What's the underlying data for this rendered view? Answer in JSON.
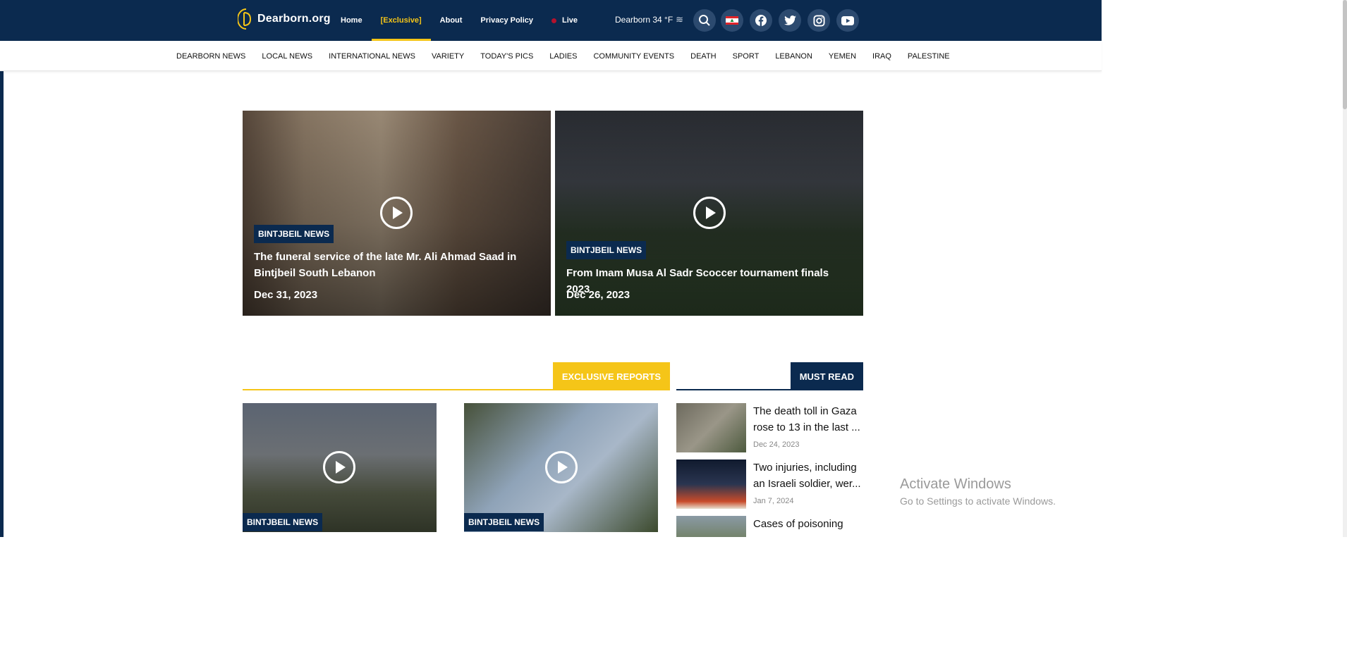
{
  "header": {
    "logo_text": "Dearborn.org",
    "nav": [
      {
        "label": "Home",
        "active": false
      },
      {
        "label": "[Exclusive]",
        "active": true
      },
      {
        "label": "About",
        "active": false
      },
      {
        "label": "Privacy Policy",
        "active": false
      },
      {
        "label": "Live",
        "active": false
      }
    ],
    "weather": "Dearborn 34 °F",
    "weather_icon": "fog-icon",
    "icons": [
      "search-icon",
      "lebanon-flag-icon",
      "facebook-icon",
      "twitter-icon",
      "instagram-icon",
      "youtube-icon"
    ],
    "brand_color": "#0b2a4f",
    "accent_color": "#f5c518"
  },
  "categories": [
    "DEARBORN NEWS",
    "LOCAL NEWS",
    "INTERNATIONAL NEWS",
    "VARIETY",
    "TODAY'S PICS",
    "LADIES",
    "COMMUNITY EVENTS",
    "DEATH",
    "SPORT",
    "LEBANON",
    "YEMEN",
    "IRAQ",
    "PALESTINE"
  ],
  "hero": [
    {
      "badge": "BINTJBEIL NEWS",
      "title": "The funeral service of the late Mr. Ali Ahmad Saad in Bintjbeil South Lebanon",
      "date": "Dec 31, 2023"
    },
    {
      "badge": "BINTJBEIL NEWS",
      "title": "From Imam Musa Al Sadr Scoccer tournament finals 2023",
      "date": "Dec 26, 2023"
    }
  ],
  "exclusive": {
    "heading": "EXCLUSIVE REPORTS",
    "cards": [
      {
        "badge": "BINTJBEIL NEWS"
      },
      {
        "badge": "BINTJBEIL NEWS"
      }
    ]
  },
  "must_read": {
    "heading": "MUST READ",
    "items": [
      {
        "title": "The death toll in Gaza rose to 13 in the last ...",
        "date": "Dec 24, 2023"
      },
      {
        "title": "Two injuries, including an Israeli soldier, wer...",
        "date": "Jan 7, 2024"
      },
      {
        "title": "Cases of poisoning",
        "date": ""
      }
    ]
  },
  "watermark": {
    "line1": "Activate Windows",
    "line2": "Go to Settings to activate Windows."
  }
}
